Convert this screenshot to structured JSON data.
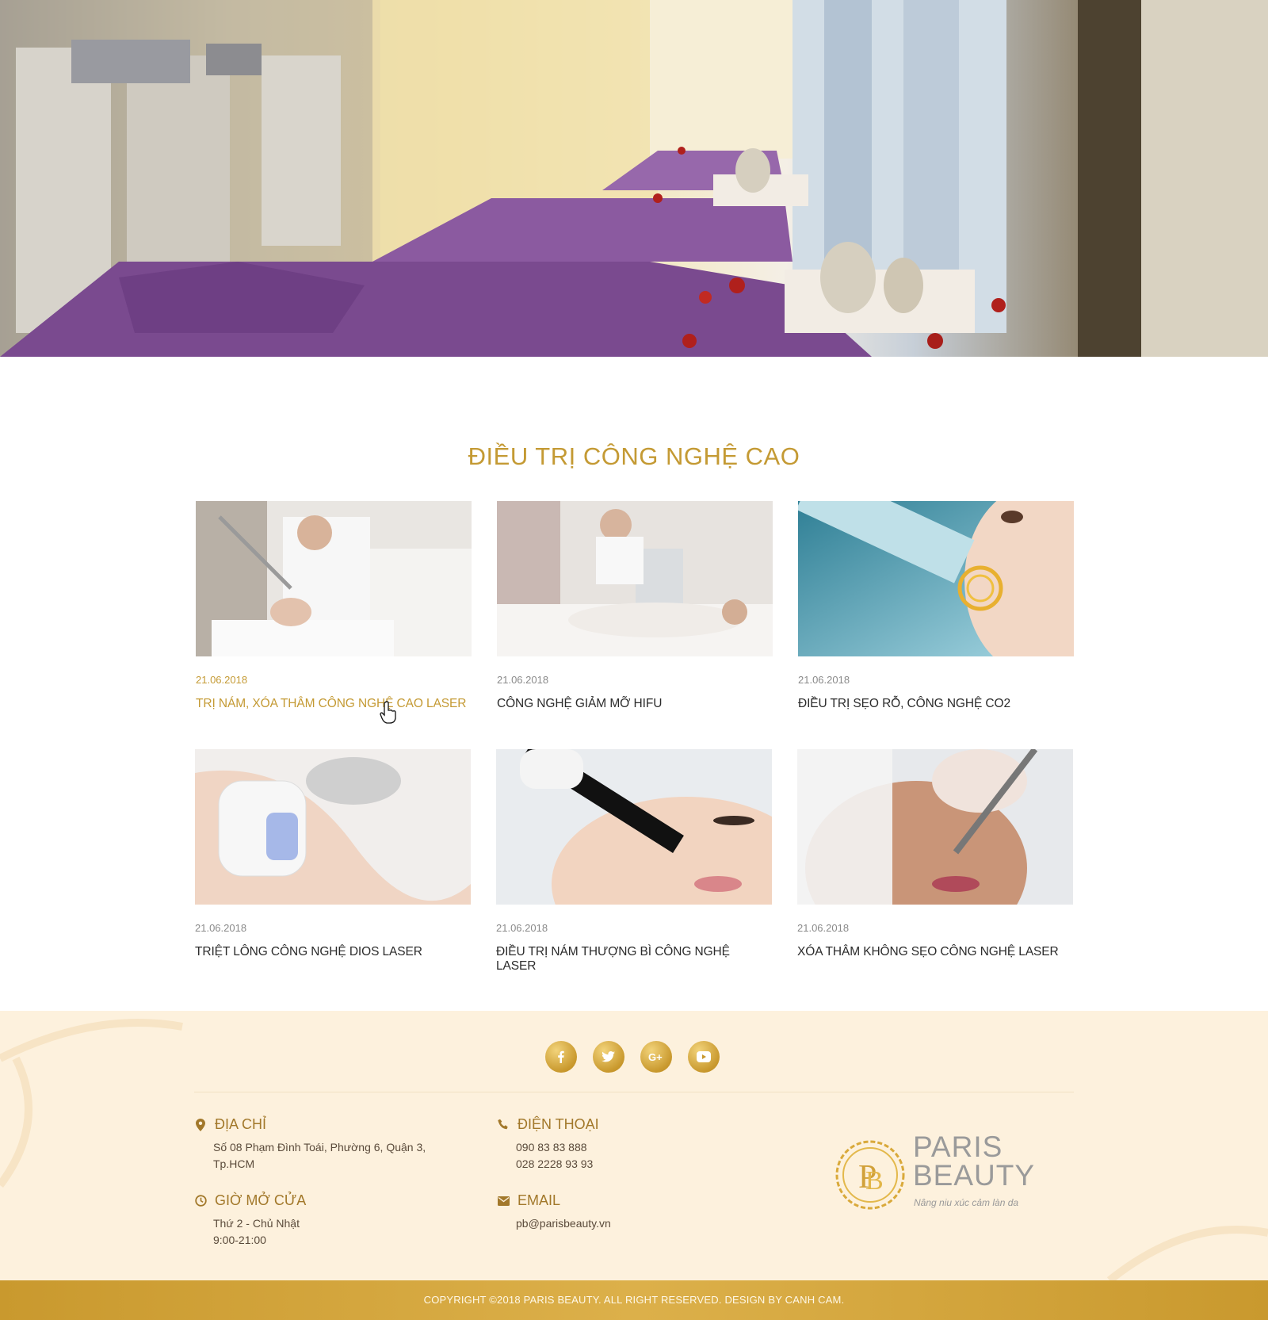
{
  "section": {
    "title": "ĐIỀU TRỊ CÔNG NGHỆ CAO"
  },
  "posts": [
    {
      "date": "21.06.2018",
      "title": "TRỊ NÁM, XÓA THÂM CÔNG NGHỆ CAO LASER",
      "active": true
    },
    {
      "date": "21.06.2018",
      "title": "CÔNG NGHỆ GIẢM MỠ HIFU",
      "active": false
    },
    {
      "date": "21.06.2018",
      "title": "ĐIỀU TRỊ SẸO RỖ, CÔNG NGHỆ CO2",
      "active": false
    },
    {
      "date": "21.06.2018",
      "title": "TRIỆT LÔNG CÔNG NGHỆ DIOS LASER",
      "active": false
    },
    {
      "date": "21.06.2018",
      "title": "ĐIỀU TRỊ NÁM THƯỢNG BÌ CÔNG NGHỆ LASER",
      "active": false
    },
    {
      "date": "21.06.2018",
      "title": "XÓA THÂM KHÔNG SẸO CÔNG NGHỆ LASER",
      "active": false
    }
  ],
  "footer": {
    "social": [
      "facebook-icon",
      "twitter-icon",
      "google-plus-icon",
      "youtube-icon"
    ],
    "address": {
      "label": "ĐỊA CHỈ",
      "line1": "Số 08 Phạm Đình Toái, Phường 6, Quận 3,",
      "line2": "Tp.HCM"
    },
    "hours": {
      "label": "GIỜ MỞ CỬA",
      "line1": "Thứ 2 - Chủ Nhật",
      "line2": "9:00-21:00"
    },
    "phone": {
      "label": "ĐIỆN THOẠI",
      "line1": "090 83 83 888",
      "line2": "028 2228 93 93"
    },
    "email": {
      "label": "EMAIL",
      "line1": "pb@parisbeauty.vn"
    },
    "logo": {
      "brand_line1": "PARIS",
      "brand_line2": "BEAUTY",
      "tagline": "Nâng niu xúc cảm làn da"
    },
    "copyright": "COPYRIGHT ©2018 PARIS BEAUTY. ALL RIGHT RESERVED. DESIGN BY CANH CAM."
  },
  "colors": {
    "accent": "#c49a34",
    "footer_bg": "#fdf1dd",
    "copyright_bg": "#c9992e"
  }
}
